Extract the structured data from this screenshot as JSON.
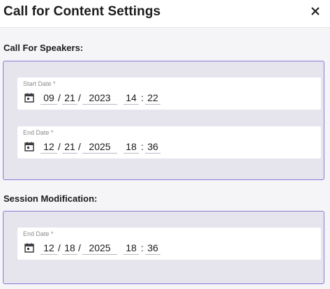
{
  "dialog": {
    "title": "Call for Content Settings"
  },
  "speakers": {
    "heading": "Call For Speakers:",
    "start": {
      "label": "Start Date *",
      "month": "09",
      "day": "21",
      "year": "2023",
      "hour": "14",
      "minute": "22"
    },
    "end": {
      "label": "End Date *",
      "month": "12",
      "day": "21",
      "year": "2025",
      "hour": "18",
      "minute": "36"
    }
  },
  "session": {
    "heading": "Session Modification:",
    "end": {
      "label": "End Date *",
      "month": "12",
      "day": "18",
      "year": "2025",
      "hour": "18",
      "minute": "36"
    }
  },
  "separators": {
    "date": "/",
    "time": ":"
  },
  "icons": {
    "close": "close-icon",
    "calendar": "calendar-icon"
  },
  "colors": {
    "accent_border": "#8f7ad8",
    "section_bg": "#e6e4ec"
  }
}
